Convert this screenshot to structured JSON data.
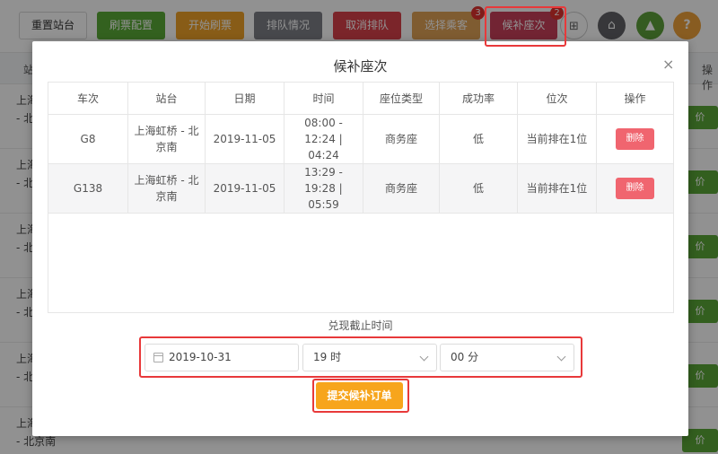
{
  "toolbar": {
    "reset_label": "重置站台",
    "config_label": "刷票配置",
    "start_label": "开始刷票",
    "queue_label": "排队情况",
    "cancel_label": "取消排队",
    "passenger_label": "选择乘客",
    "seat_label": "候补座次",
    "passenger_badge": "3",
    "seat_badge": "2",
    "icon1": "⊞",
    "icon2": "⌂",
    "icon3": "▲",
    "icon4": "?"
  },
  "background_table": {
    "header_left": "站",
    "header_right": "操作",
    "rows": [
      {
        "station": "上海\n- 北",
        "action": "价"
      },
      {
        "station": "上海\n- 北",
        "action": "价"
      },
      {
        "station": "上海\n- 北",
        "action": "价"
      },
      {
        "station": "上海\n- 北",
        "action": "价"
      },
      {
        "station": "上海\n- 北",
        "action": "价"
      },
      {
        "station": "上海\n- 北京南",
        "action": "价"
      }
    ]
  },
  "modal": {
    "title": "候补座次",
    "close": "×",
    "columns": [
      "车次",
      "站台",
      "日期",
      "时间",
      "座位类型",
      "成功率",
      "位次",
      "操作"
    ],
    "rows": [
      {
        "train": "G8",
        "station": "上海虹桥 - 北京南",
        "date": "2019-11-05",
        "time": "08:00 - 12:24 | 04:24",
        "seat_type": "商务座",
        "rate": "低",
        "rank": "当前排在1位",
        "action": "删除"
      },
      {
        "train": "G138",
        "station": "上海虹桥 - 北京南",
        "date": "2019-11-05",
        "time": "13:29 - 19:28 | 05:59",
        "seat_type": "商务座",
        "rate": "低",
        "rank": "当前排在1位",
        "action": "删除"
      }
    ],
    "deadline_label": "兑现截止时间",
    "date_value": "2019-10-31",
    "hour_value": "19 时",
    "minute_value": "00 分",
    "submit_label": "提交候补订单"
  }
}
